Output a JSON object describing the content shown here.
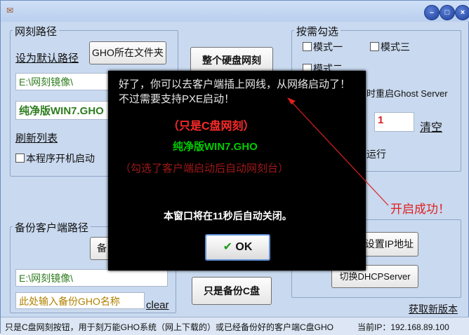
{
  "window": {
    "title": ""
  },
  "left_group": {
    "title": "网刻路径",
    "default_path_link": "设为默认路径",
    "gho_folder_button": "GHO所在文件夹",
    "path_value": "E:\\网刻镜像\\",
    "gho_select_value": "纯净版WIN7.GHO",
    "refresh_link": "刷新列表",
    "autostart_checkbox": "本程序开机启动"
  },
  "center_buttons": {
    "whole_disk": "整个硬盘网刻",
    "backup_c": "只是备份C盘"
  },
  "right_group": {
    "title": "按需勾选",
    "mode1": "模式一",
    "mode2": "模式二",
    "mode3": "模式三",
    "restart_ghost": "时重启Ghost Server",
    "count_value": "1",
    "clear_link": "清空",
    "run_label": "运行"
  },
  "backup_group": {
    "title": "备份客户端路径",
    "button_partial": "备",
    "path_value": "E:\\网刻镜像\\",
    "name_placeholder": "此处输入备份GHO名称",
    "clear_link": "clear"
  },
  "right_bottom": {
    "set_ip_button": "设置IP地址",
    "switch_dhcp_button": "切换DHCPServer",
    "get_new_version_link": "获取新版本"
  },
  "status_bar": {
    "hint": "只是C盘网刻按钮，用于刻万能GHO系统（网上下载的）或已经备份好的客户端C盘GHO",
    "ip_label": "当前IP：192.168.89.100"
  },
  "dialog": {
    "message": "好了，你可以去客户端插上网线，从网络启动了！ 不过需要支持PXE启动！",
    "mode_line": "（只是C盘网刻）",
    "gho_name": "纯净版WIN7.GHO",
    "hint_line": "（勾选了客户端启动后自动网刻台）",
    "countdown": "本窗口将在11秒后自动关闭。",
    "ok_label": "OK",
    "ok_icon": "check-icon"
  },
  "annotation": {
    "label": "开启成功！",
    "color": "#e02020"
  },
  "colors": {
    "window_bg": "#c9d9ef",
    "dialog_bg": "#000000",
    "success_green": "#00cc00",
    "path_green": "#2e7d1f"
  }
}
